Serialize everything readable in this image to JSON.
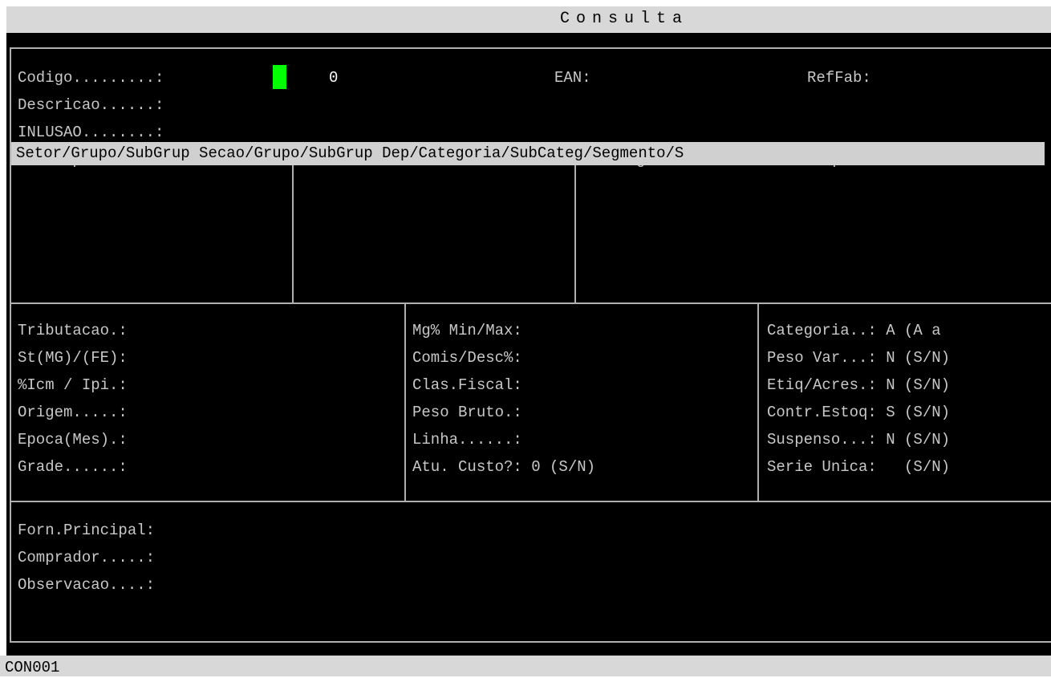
{
  "window": {
    "title": "Consulta"
  },
  "header_fields": {
    "codigo_label": "Codigo.........:",
    "codigo_value": "0",
    "ean_label": "EAN:",
    "reffab_label": "RefFab:",
    "descricao_label": "Descricao......:",
    "inclusao_label": "INLUSAO........:",
    "un_label": "Un Compra/Venda:",
    "un_compra": "UN",
    "fator": "1.0000",
    "un_venda": "UN",
    "dias_giro_label": "Dias Giro/Seg:",
    "aplic_label": "Aplic:"
  },
  "grid_header": "Setor/Grupo/SubGrup Secao/Grupo/SubGrup Dep/Categoria/SubCateg/Segmento/S",
  "col1": [
    "Tributacao.:",
    "St(MG)/(FE):",
    "%Icm / Ipi.:",
    "Origem.....:",
    "Epoca(Mes).:",
    "Grade......:"
  ],
  "col2": [
    "Mg% Min/Max:",
    "Comis/Desc%:",
    "Clas.Fiscal:",
    "Peso Bruto.:",
    "Linha......:",
    "Atu. Custo?: 0 (S/N)"
  ],
  "col3": [
    "Categoria..: A (A a",
    "Peso Var...: N (S/N)",
    "Etiq/Acres.: N (S/N)",
    "Contr.Estoq: S (S/N)",
    "Suspenso...: N (S/N)",
    "Serie Unica:   (S/N)"
  ],
  "footer_fields": {
    "forn_label": "Forn.Principal:",
    "comprador_label": "Comprador.....:",
    "observacao_label": "Observacao....:"
  },
  "status_bar": {
    "program": "CON001"
  },
  "colors": {
    "cursor": "#00ff00",
    "background": "#000000",
    "text": "#c8c8c8"
  }
}
